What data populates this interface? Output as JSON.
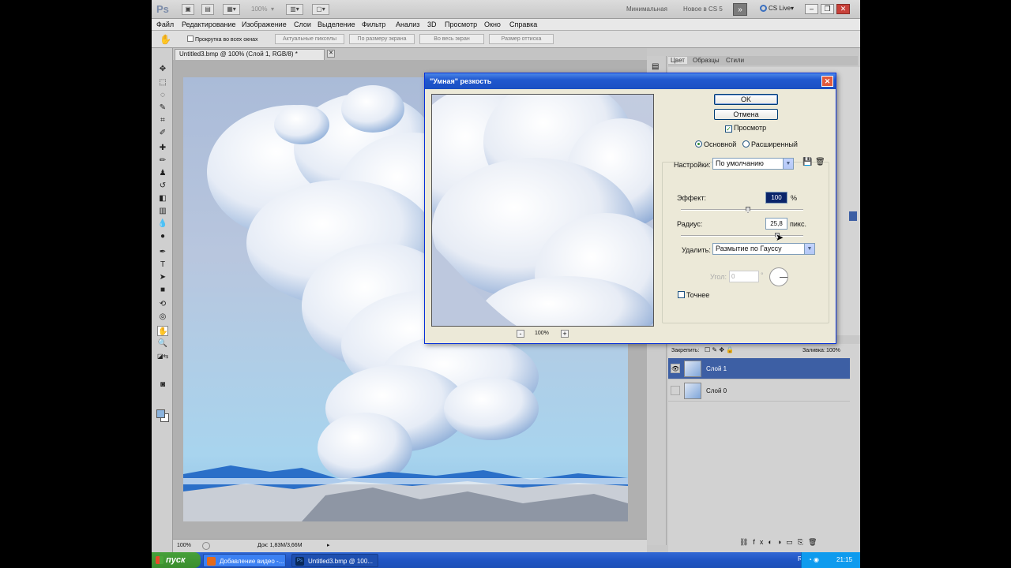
{
  "appbar": {
    "logo": "Ps",
    "zoom": "100%",
    "workspaces": [
      "Минимальная",
      "Новое в CS 5"
    ],
    "more": "»",
    "cslive": "CS Live"
  },
  "menu": [
    "Файл",
    "Редактирование",
    "Изображение",
    "Слои",
    "Выделение",
    "Фильтр",
    "Анализ",
    "3D",
    "Просмотр",
    "Окно",
    "Справка"
  ],
  "options": {
    "scroll_all": "Прокрутка во всех окнах",
    "buttons": [
      "Актуальные пикселы",
      "По размеру экрана",
      "Во весь экран",
      "Размер оттиска"
    ]
  },
  "document": {
    "tab": "Untitled3.bmp @ 100% (Слой 1, RGB/8) *",
    "status_zoom": "100%",
    "status_doc": "Док: 1,83М/3,66М"
  },
  "panels": {
    "tabs": [
      "Цвет",
      "Образцы",
      "Стили"
    ],
    "lock_label": "Закрепить:",
    "fill_label": "Заливка:",
    "fill_value": "100%",
    "layers": [
      {
        "name": "Слой 1",
        "selected": true
      },
      {
        "name": "Слой 0",
        "selected": false
      }
    ]
  },
  "dialog": {
    "title": "\"Умная\" резкость",
    "ok": "OK",
    "cancel": "Отмена",
    "preview": "Просмотр",
    "mode_basic": "Основной",
    "mode_advanced": "Расширенный",
    "settings_label": "Настройки:",
    "settings_value": "По умолчанию",
    "amount_label": "Эффект:",
    "amount_value": "100",
    "amount_unit": "%",
    "radius_label": "Радиус:",
    "radius_value": "25,8",
    "radius_unit": "пикс.",
    "remove_label": "Удалить:",
    "remove_value": "Размытие по Гауссу",
    "angle_label": "Угол:",
    "angle_value": "0",
    "angle_unit": "°",
    "more_accurate": "Точнее",
    "zoom": "100%",
    "zoom_minus": "-",
    "zoom_plus": "+"
  },
  "taskbar": {
    "start": "пуск",
    "items": [
      "Добавление видео -...",
      "Untitled3.bmp @ 100..."
    ],
    "lang": "RU",
    "time": "21:15"
  }
}
